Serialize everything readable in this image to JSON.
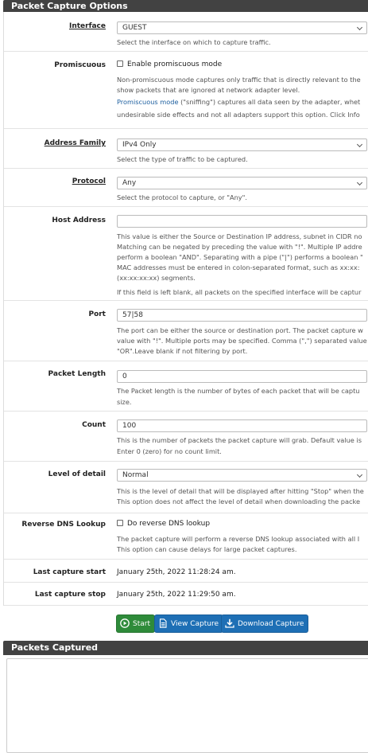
{
  "options_panel": {
    "title": "Packet Capture Options"
  },
  "interface": {
    "label": "Interface",
    "value": "GUEST",
    "help": "Select the interface on which to capture traffic."
  },
  "promiscuous": {
    "label": "Promiscuous",
    "checkbox_label": "Enable promiscuous mode",
    "help_line1": "Non-promiscuous mode captures only traffic that is directly relevant to the",
    "help_line2": "show packets that are ignored at network adapter level.",
    "help_link": "Promiscuous mode",
    "help_line3_rest": " (\"sniffing\") captures all data seen by the adapter, whet",
    "help_line4": "undesirable side effects and not all adapters support this option. Click Info"
  },
  "address_family": {
    "label": "Address Family",
    "value": "IPv4 Only",
    "help": "Select the type of traffic to be captured."
  },
  "protocol": {
    "label": "Protocol",
    "value": "Any",
    "help": "Select the protocol to capture, or \"Any\"."
  },
  "host_address": {
    "label": "Host Address",
    "value": "",
    "help_line1": "This value is either the Source or Destination IP address, subnet in CIDR no",
    "help_line2": "Matching can be negated by preceding the value with \"!\". Multiple IP addre",
    "help_line3": "perform a boolean \"AND\". Separating with a pipe (\"|\") performs a boolean \"",
    "help_line4": "MAC addresses must be entered in colon-separated format, such as xx:xx:",
    "help_line5": "(xx:xx:xx:xx) segments.",
    "help_line6": "If this field is left blank, all packets on the specified interface will be captur"
  },
  "port": {
    "label": "Port",
    "value": "57|58",
    "help_line1": "The port can be either the source or destination port. The packet capture w",
    "help_line2": "value with \"!\". Multiple ports may be specified. Comma (\",\") separated value",
    "help_line3": "\"OR\".Leave blank if not filtering by port."
  },
  "packet_length": {
    "label": "Packet Length",
    "value": "0",
    "help_line1": "The Packet length is the number of bytes of each packet that will be captu",
    "help_line2": "size."
  },
  "count": {
    "label": "Count",
    "value": "100",
    "help_line1": "This is the number of packets the packet capture will grab. Default value is",
    "help_line2": "Enter 0 (zero) for no count limit."
  },
  "level_of_detail": {
    "label": "Level of detail",
    "value": "Normal",
    "help_line1": "This is the level of detail that will be displayed after hitting \"Stop\" when the",
    "help_line2": "This option does not affect the level of detail when downloading the packe"
  },
  "reverse_dns": {
    "label": "Reverse DNS Lookup",
    "checkbox_label": "Do reverse DNS lookup",
    "help_line1": "The packet capture will perform a reverse DNS lookup associated with all I",
    "help_line2": "This option can cause delays for large packet captures."
  },
  "last_capture_start": {
    "label": "Last capture start",
    "value": "January 25th, 2022 11:28:24 am."
  },
  "last_capture_stop": {
    "label": "Last capture stop",
    "value": "January 25th, 2022 11:29:50 am."
  },
  "buttons": {
    "start": "Start",
    "view_capture": "View Capture",
    "download_capture": "Download Capture"
  },
  "captured_panel": {
    "title": "Packets Captured"
  },
  "colors": {
    "panel_heading": "#424242",
    "start_button": "#2e8b3a",
    "primary_button": "#1e6fb5",
    "link": "#1d5f9f"
  },
  "icons": {
    "start": "play-circle-icon",
    "view": "file-icon",
    "download": "download-icon",
    "select": "chevron-down-icon"
  }
}
